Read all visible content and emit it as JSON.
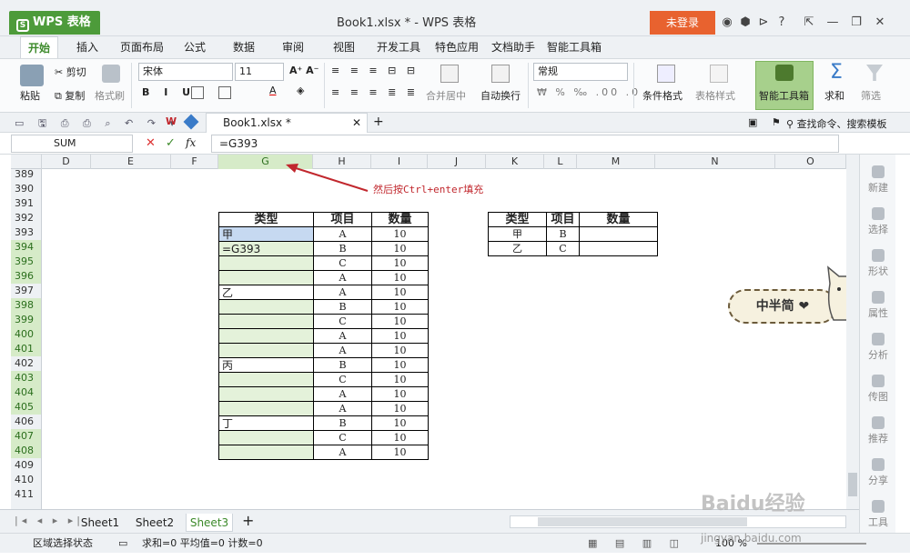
{
  "window": {
    "app_name": "WPS 表格",
    "title": "Book1.xlsx * - WPS 表格",
    "login": "未登录",
    "help": "?"
  },
  "tabs": [
    "开始",
    "插入",
    "页面布局",
    "公式",
    "数据",
    "审阅",
    "视图",
    "开发工具",
    "特色应用",
    "文档助手",
    "智能工具箱"
  ],
  "ribbon": {
    "paste": "粘贴",
    "cut": "剪切",
    "copy": "复制",
    "format_painter": "格式刷",
    "font": "宋体",
    "font_size": "11",
    "merge_center": "合并居中",
    "wrap_text": "自动换行",
    "number_format": "常规",
    "cond_format": "条件格式",
    "table_style": "表格样式",
    "smart_toolbox": "智能工具箱",
    "sum": "求和",
    "filter": "筛选"
  },
  "quickbar": {
    "doc_tab": "Book1.xlsx *",
    "search": "查找命令、搜索模板"
  },
  "formula_bar": {
    "name_box": "SUM",
    "fx": "fx",
    "formula": "=G393"
  },
  "columns": [
    "D",
    "E",
    "F",
    "G",
    "H",
    "I",
    "J",
    "K",
    "L",
    "M",
    "N",
    "O"
  ],
  "rows": [
    "389",
    "390",
    "391",
    "392",
    "393",
    "394",
    "395",
    "396",
    "397",
    "398",
    "399",
    "400",
    "401",
    "402",
    "403",
    "404",
    "405",
    "406",
    "407",
    "408",
    "409",
    "410",
    "411"
  ],
  "table1": {
    "headers": [
      "类型",
      "项目",
      "数量"
    ],
    "rows": [
      [
        "甲",
        "A",
        "10"
      ],
      [
        "=G393",
        "B",
        "10"
      ],
      [
        "",
        "C",
        "10"
      ],
      [
        "",
        "A",
        "10"
      ],
      [
        "乙",
        "A",
        "10"
      ],
      [
        "",
        "B",
        "10"
      ],
      [
        "",
        "C",
        "10"
      ],
      [
        "",
        "A",
        "10"
      ],
      [
        "",
        "A",
        "10"
      ],
      [
        "丙",
        "B",
        "10"
      ],
      [
        "",
        "C",
        "10"
      ],
      [
        "",
        "A",
        "10"
      ],
      [
        "",
        "A",
        "10"
      ],
      [
        "丁",
        "B",
        "10"
      ],
      [
        "",
        "C",
        "10"
      ],
      [
        "",
        "A",
        "10"
      ]
    ]
  },
  "table2": {
    "headers": [
      "类型",
      "项目",
      "数量"
    ],
    "rows": [
      [
        "甲",
        "B",
        ""
      ],
      [
        "乙",
        "C",
        ""
      ]
    ]
  },
  "annotation": "然后按Ctrl+enter填充",
  "sticker": "中半简 ❤",
  "right_panel": [
    "新建",
    "选择",
    "形状",
    "属性",
    "分析",
    "传图",
    "推荐",
    "分享",
    "工具"
  ],
  "sheets": [
    "Sheet1",
    "Sheet2",
    "Sheet3"
  ],
  "status": {
    "mode": "区域选择状态",
    "stats": "求和=0  平均值=0  计数=0",
    "zoom": "100 %"
  },
  "watermark": {
    "brand": "Baidu经验",
    "url": "jingyan.baidu.com"
  },
  "colors": {
    "accent": "#4d9b3a",
    "login": "#e8622f",
    "selection": "#e4f2da",
    "active_cell": "#c6d9f1",
    "annotation": "#c1272d"
  }
}
